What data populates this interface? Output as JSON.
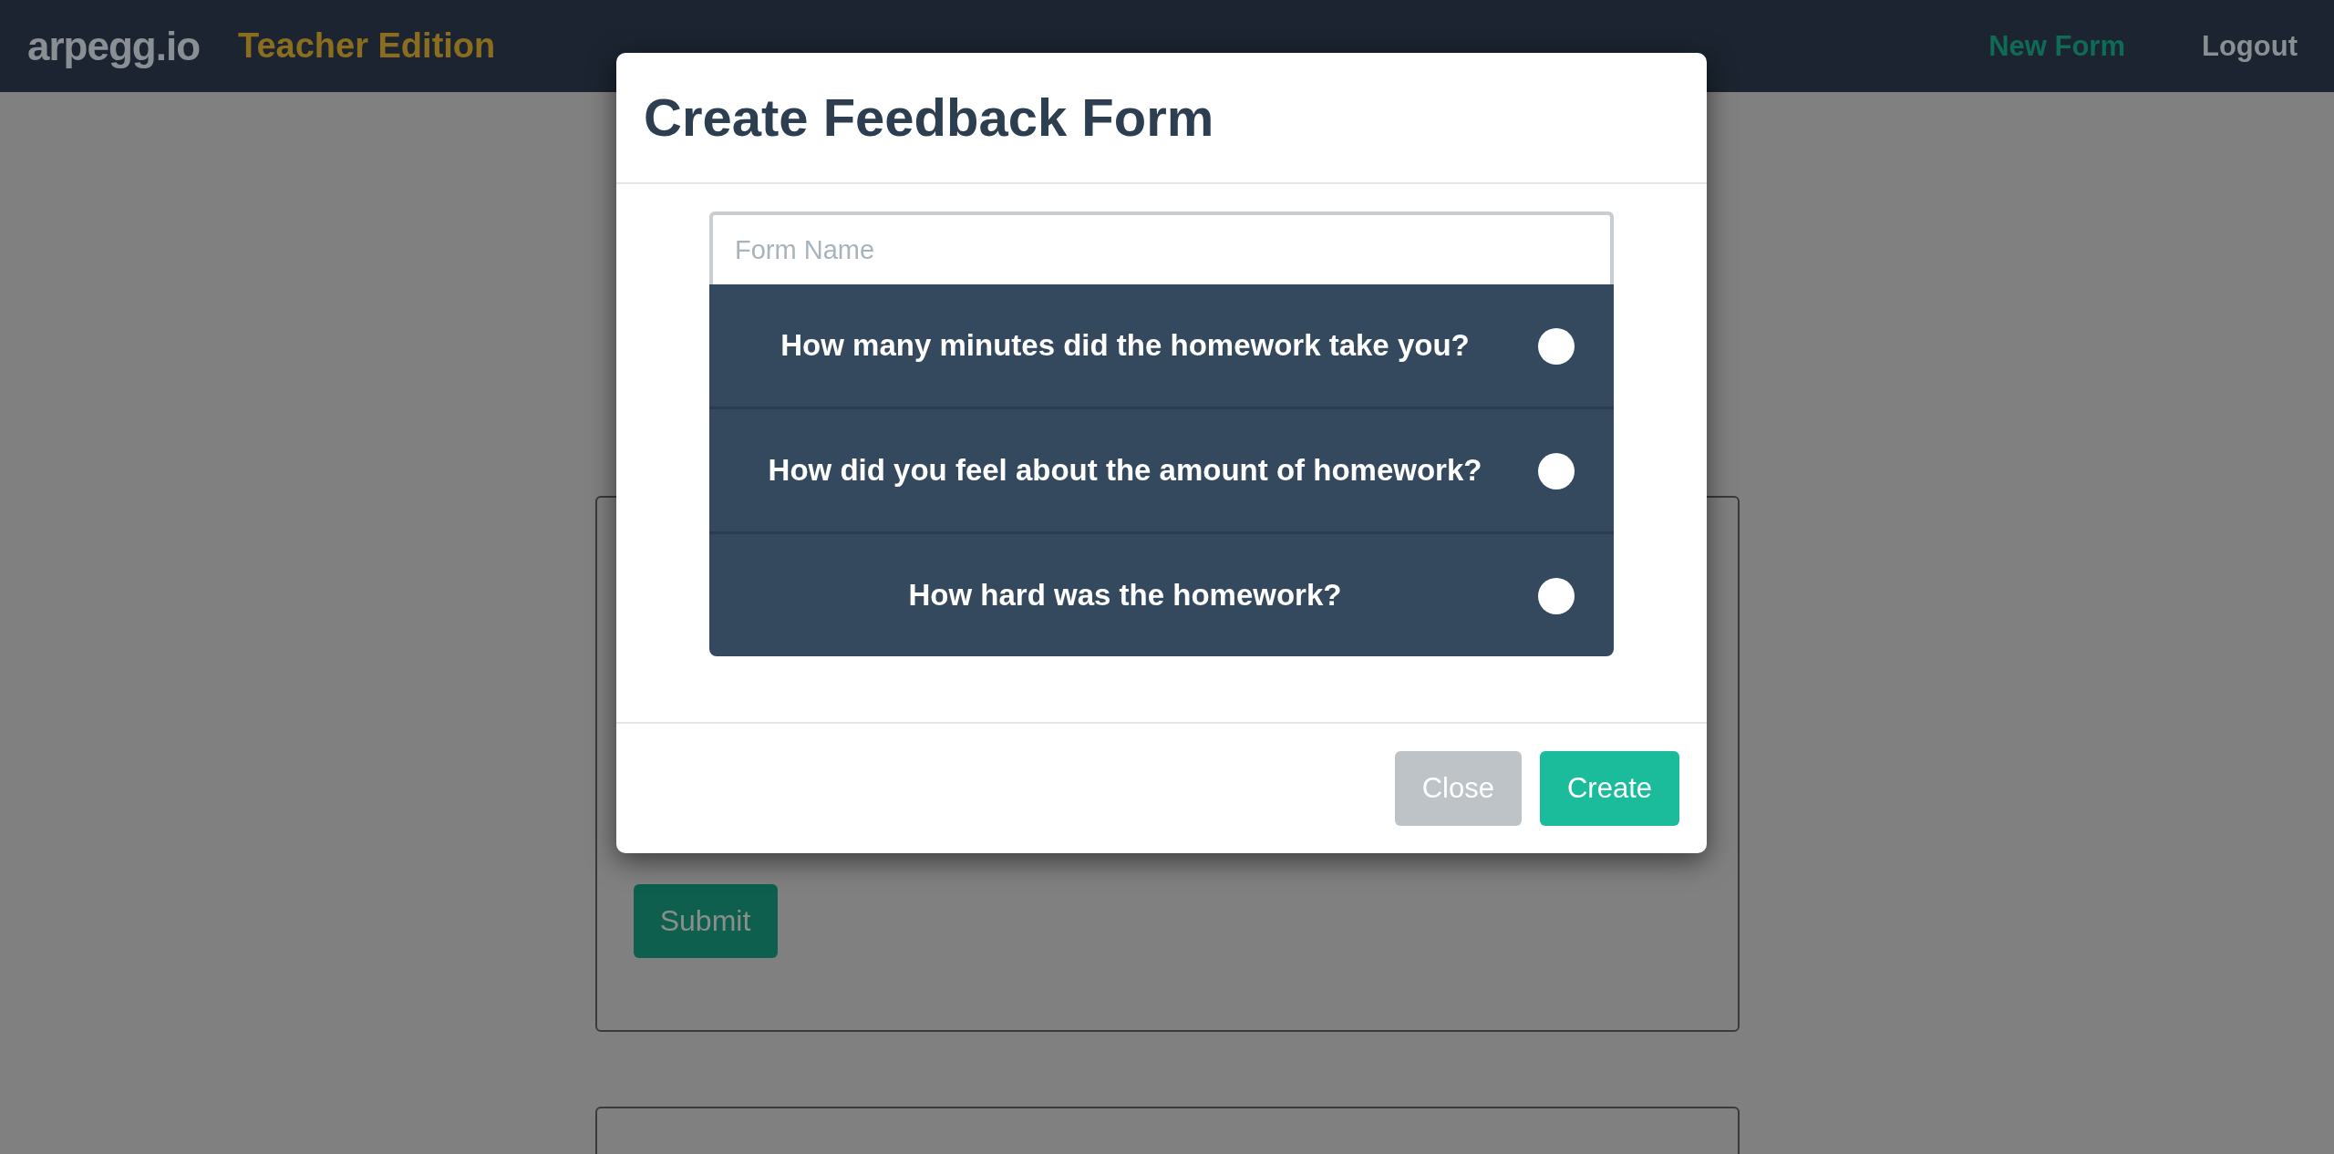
{
  "navbar": {
    "brand": "arpegg.io",
    "edition": "Teacher Edition",
    "links": [
      {
        "label": "New Form",
        "selected": true
      },
      {
        "label": "Logout",
        "selected": false
      }
    ]
  },
  "background": {
    "submit_button": "Submit"
  },
  "modal": {
    "title": "Create Feedback Form",
    "form_name": {
      "placeholder": "Form Name"
    },
    "questions": [
      {
        "text": "How many minutes did the homework take you?",
        "checked": false
      },
      {
        "text": "How did you feel about the amount of homework?",
        "checked": false
      },
      {
        "text": "How hard was the homework?",
        "checked": false
      }
    ],
    "buttons": [
      {
        "label": "Close",
        "kind": "secondary"
      },
      {
        "label": "Create",
        "kind": "primary"
      }
    ]
  }
}
